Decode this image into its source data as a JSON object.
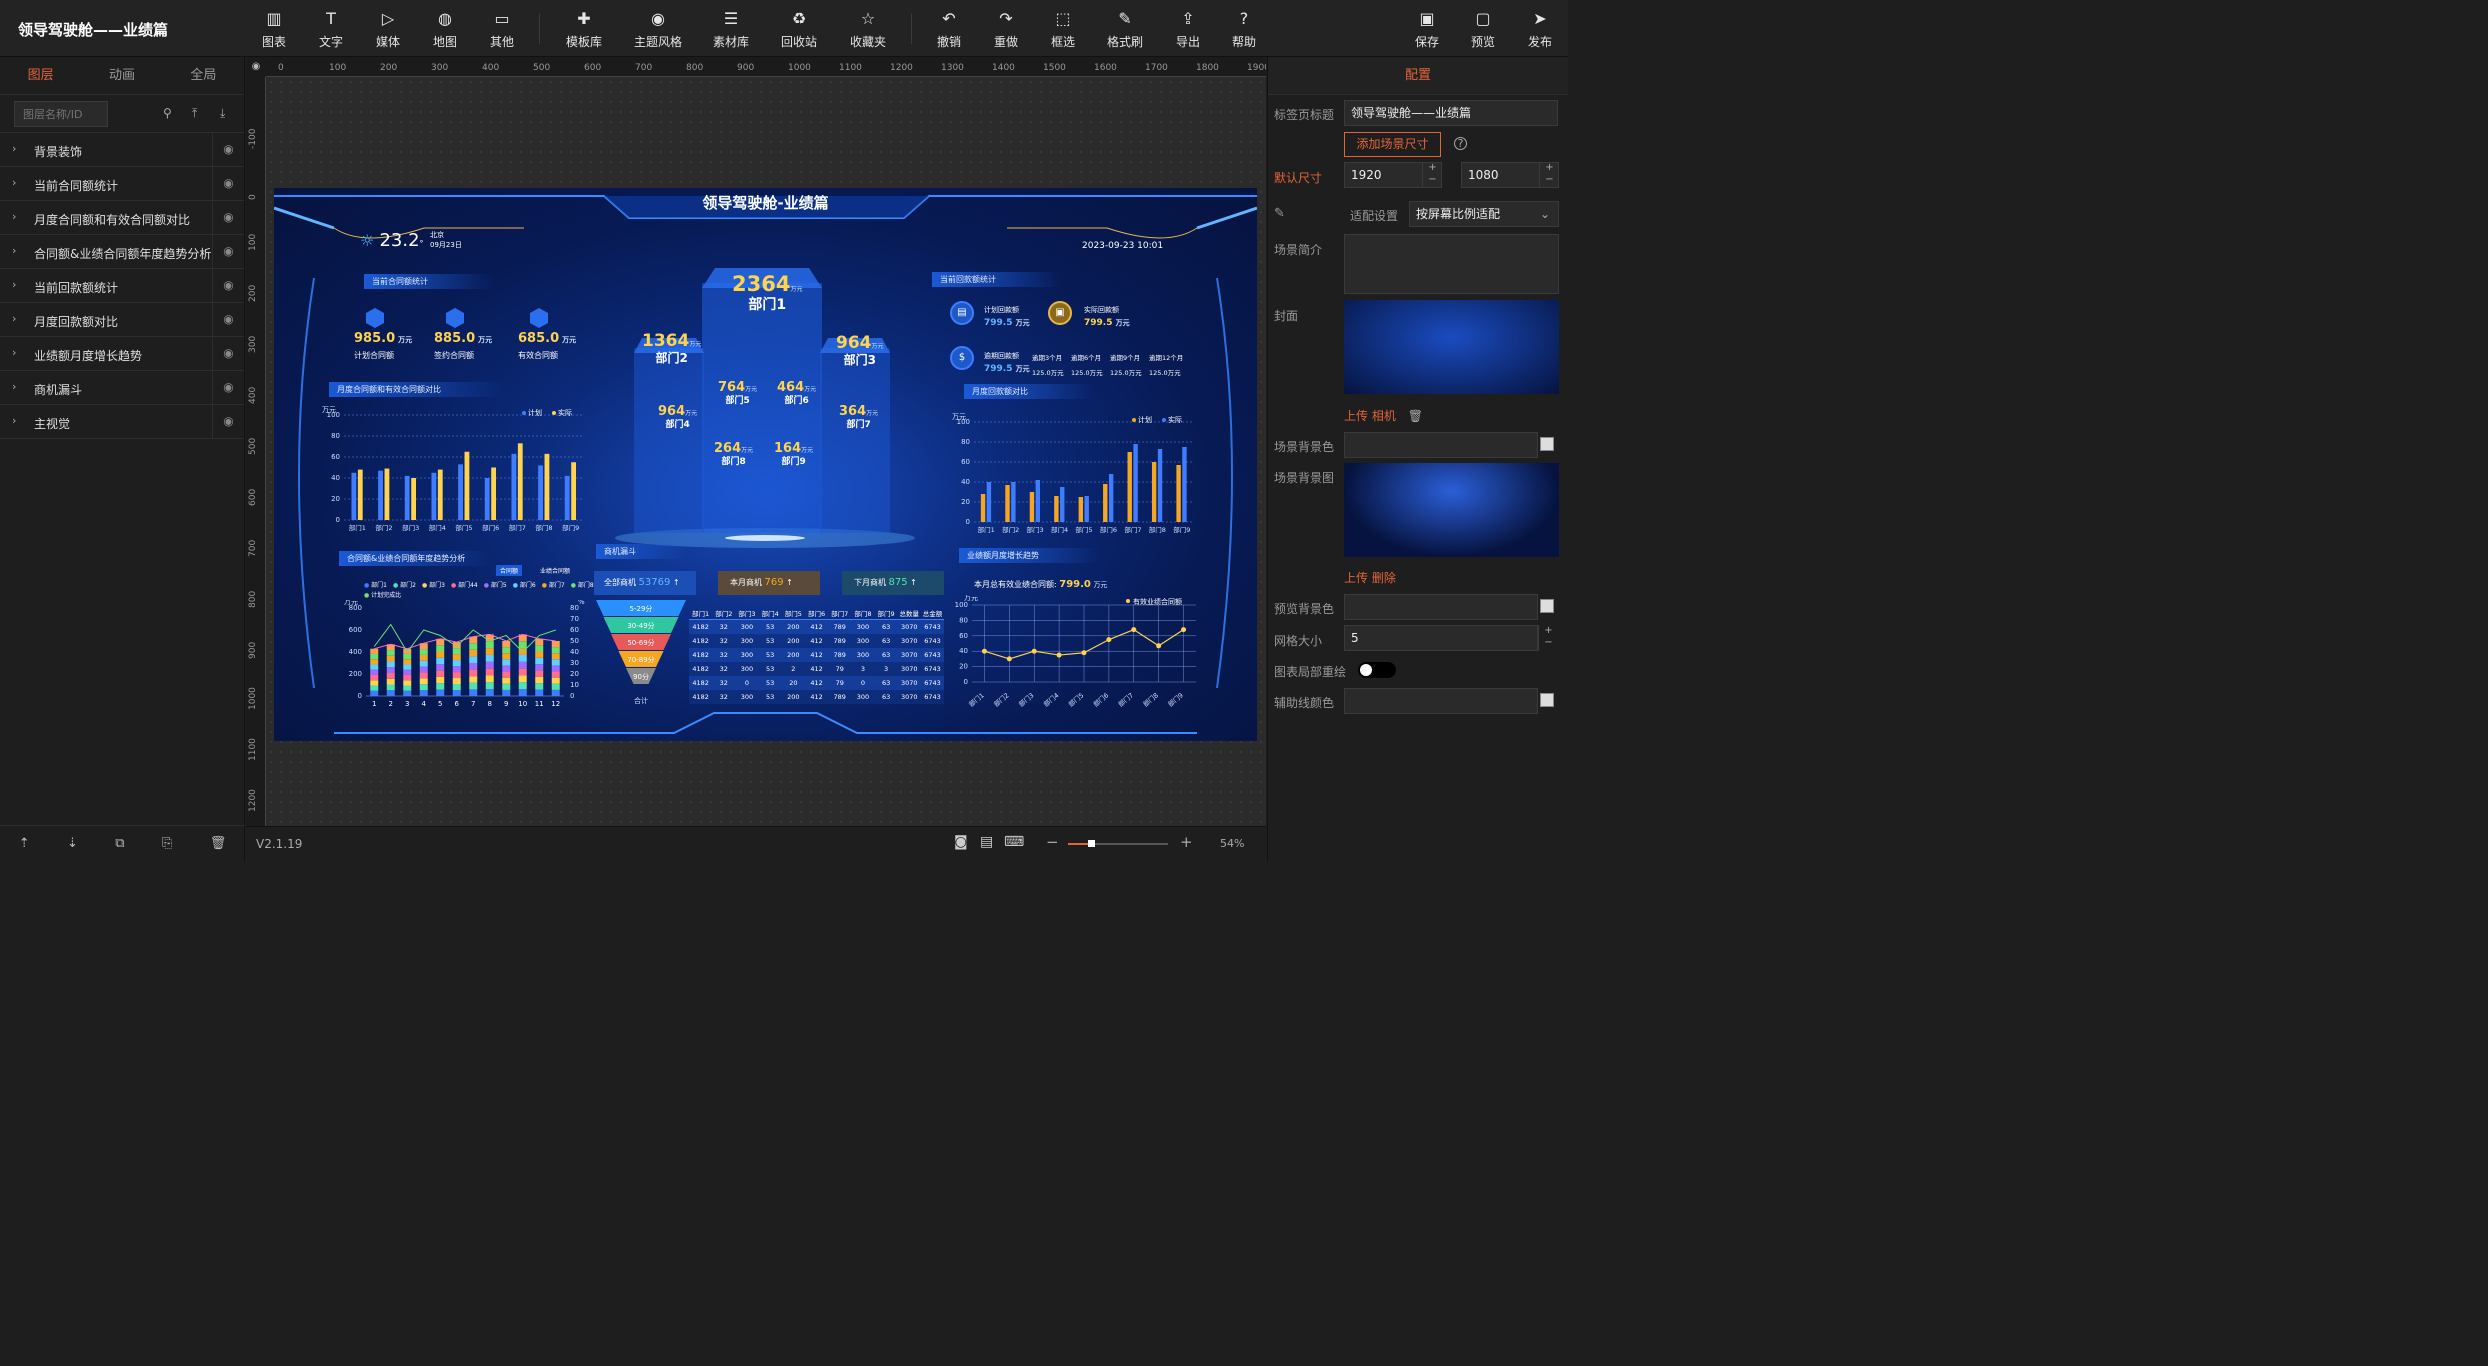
{
  "app": {
    "title": "领导驾驶舱——业绩篇",
    "version": "V2.1.19",
    "zoom": "54%"
  },
  "toolbar": {
    "left": [
      {
        "icon": "chart-icon",
        "glyph": "▥",
        "label": "图表"
      },
      {
        "icon": "text-icon",
        "glyph": "T",
        "label": "文字"
      },
      {
        "icon": "media-icon",
        "glyph": "▷",
        "label": "媒体"
      },
      {
        "icon": "map-icon",
        "glyph": "◍",
        "label": "地图"
      },
      {
        "icon": "other-icon",
        "glyph": "▭",
        "label": "其他"
      }
    ],
    "middle": [
      {
        "icon": "template-icon",
        "glyph": "✚",
        "label": "模板库"
      },
      {
        "icon": "theme-icon",
        "glyph": "◉",
        "label": "主题风格"
      },
      {
        "icon": "assets-icon",
        "glyph": "☰",
        "label": "素材库"
      },
      {
        "icon": "recycle-icon",
        "glyph": "♻",
        "label": "回收站"
      },
      {
        "icon": "star-icon",
        "glyph": "☆",
        "label": "收藏夹"
      }
    ],
    "right": [
      {
        "icon": "undo-icon",
        "glyph": "↶",
        "label": "撤销"
      },
      {
        "icon": "redo-icon",
        "glyph": "↷",
        "label": "重做"
      },
      {
        "icon": "select-icon",
        "glyph": "⬚",
        "label": "框选"
      },
      {
        "icon": "format-brush-icon",
        "glyph": "✎",
        "label": "格式刷"
      },
      {
        "icon": "export-icon",
        "glyph": "⇪",
        "label": "导出"
      },
      {
        "icon": "help-icon",
        "glyph": "?",
        "label": "帮助"
      }
    ],
    "far": [
      {
        "icon": "save-icon",
        "glyph": "▣",
        "label": "保存"
      },
      {
        "icon": "preview-icon",
        "glyph": "▢",
        "label": "预览"
      },
      {
        "icon": "publish-icon",
        "glyph": "➤",
        "label": "发布"
      }
    ]
  },
  "left_panel": {
    "tabs": [
      "图层",
      "动画",
      "全局"
    ],
    "search_placeholder": "图层名称/ID",
    "layers": [
      "背景装饰",
      "当前合同额统计",
      "月度合同额和有效合同额对比",
      "合同额&业绩合同额年度趋势分析",
      "当前回款额统计",
      "月度回款额对比",
      "业绩额月度增长趋势",
      "商机漏斗",
      "主视觉"
    ]
  },
  "ruler": {
    "x_ticks": [
      "0",
      "100",
      "200",
      "300",
      "400",
      "500",
      "600",
      "700",
      "800",
      "900",
      "1000",
      "1100",
      "1200",
      "1300",
      "1400",
      "1500",
      "1600",
      "1700",
      "1800",
      "1900"
    ],
    "y_ticks": [
      "-100",
      "0",
      "100",
      "200",
      "300",
      "400",
      "500",
      "600",
      "700",
      "800",
      "900",
      "1000",
      "1100",
      "1200"
    ]
  },
  "right_panel": {
    "header": "配置",
    "tab_title_label": "标签页标题",
    "tab_title_value": "领导驾驶舱——业绩篇",
    "add_size_button": "添加场景尺寸",
    "default_size_label": "默认尺寸",
    "width": "1920",
    "height": "1080",
    "fit_label": "适配设置",
    "fit_value": "按屏幕比例适配",
    "intro_label": "场景简介",
    "cover_label": "封面",
    "upload": "上传",
    "camera": "相机",
    "delete": "删除",
    "bg_color_label": "场景背景色",
    "bg_image_label": "场景背景图",
    "preview_bg_label": "预览背景色",
    "grid_label": "网格大小",
    "grid_value": "5",
    "local_redraw_label": "图表局部重绘",
    "guide_color_label": "辅助线颜色"
  },
  "screen": {
    "title": "领导驾驶舱-业绩篇",
    "temp": "23.2",
    "temp_unit": "°",
    "city": "北京",
    "date": "09月23日",
    "datetime": "2023-09-23 10:01",
    "contract": {
      "title": "当前合同额统计",
      "items": [
        {
          "v": "985.0",
          "u": "万元",
          "l": "计划合同额"
        },
        {
          "v": "885.0",
          "u": "万元",
          "l": "签约合同额"
        },
        {
          "v": "685.0",
          "u": "万元",
          "l": "有效合同额"
        }
      ]
    },
    "depts": [
      {
        "v": "2364",
        "n": "部门1"
      },
      {
        "v": "1364",
        "n": "部门2"
      },
      {
        "v": "964",
        "n": "部门3"
      },
      {
        "v": "964",
        "n": "部门4"
      },
      {
        "v": "764",
        "n": "部门5"
      },
      {
        "v": "464",
        "n": "部门6"
      },
      {
        "v": "364",
        "n": "部门7"
      },
      {
        "v": "264",
        "n": "部门8"
      },
      {
        "v": "164",
        "n": "部门9"
      }
    ],
    "dept_unit": "万元",
    "payback": {
      "title": "当前回款额统计",
      "plan_label": "计划回款额",
      "plan": "799.5",
      "actual_label": "实际回款额",
      "actual": "799.5",
      "overdue_label": "逾期回款额",
      "overdue": "799.5",
      "unit": "万元",
      "periods": [
        {
          "l": "逾期3个月",
          "v": "125.0万元"
        },
        {
          "l": "逾期6个月",
          "v": "125.0万元"
        },
        {
          "l": "逾期9个月",
          "v": "125.0万元"
        },
        {
          "l": "逾期12个月",
          "v": "125.0万元"
        }
      ]
    },
    "monthly_contract": {
      "title": "月度合同额和有效合同额对比",
      "unit": "万元",
      "legend": [
        "计划",
        "实际"
      ]
    },
    "monthly_payback": {
      "title": "月度回款额对比",
      "unit": "万元",
      "legend": [
        "计划",
        "实际"
      ]
    },
    "trend": {
      "title": "合同额&业绩合同额年度趋势分析",
      "tabs": [
        "合同额",
        "业绩合同额"
      ],
      "legend": [
        "部门1",
        "部门2",
        "部门3",
        "部门44",
        "部门5",
        "部门6",
        "部门7",
        "部门8",
        "部门9",
        "总合同额",
        "计划完成比"
      ],
      "unit": "万元",
      "unit2": "%"
    },
    "funnel": {
      "title": "商机漏斗",
      "all_label": "全部商机",
      "all": "53769",
      "month_label": "本月商机",
      "month": "769",
      "next_label": "下月商机",
      "next": "875",
      "stages": [
        "5-29分",
        "30-49分",
        "50-69分",
        "70-89分",
        "90分"
      ],
      "total": "合计",
      "headers": [
        "部门1",
        "部门2",
        "部门3",
        "部门4",
        "部门5",
        "部门6",
        "部门7",
        "部门8",
        "部门9",
        "总数量",
        "总金额"
      ],
      "rows": [
        [
          "4182",
          "32",
          "300",
          "53",
          "200",
          "412",
          "789",
          "300",
          "63",
          "3070",
          "6743"
        ],
        [
          "4182",
          "32",
          "300",
          "53",
          "200",
          "412",
          "789",
          "300",
          "63",
          "3070",
          "6743"
        ],
        [
          "4182",
          "32",
          "300",
          "53",
          "200",
          "412",
          "789",
          "300",
          "63",
          "3070",
          "6743"
        ],
        [
          "4182",
          "32",
          "300",
          "53",
          "2",
          "412",
          "79",
          "3",
          "3",
          "3070",
          "6743"
        ],
        [
          "4182",
          "32",
          "0",
          "53",
          "20",
          "412",
          "79",
          "0",
          "63",
          "3070",
          "6743"
        ],
        [
          "4182",
          "32",
          "300",
          "53",
          "200",
          "412",
          "789",
          "300",
          "63",
          "3070",
          "6743"
        ]
      ]
    },
    "growth": {
      "title": "业绩额月度增长趋势",
      "label": "本月总有效业绩合同额:",
      "value": "799.0",
      "unit": "万元",
      "series": "有效业绩合同额",
      "yunit": "万元"
    }
  },
  "chart_data": [
    {
      "type": "bar",
      "title": "月度合同额和有效合同额对比",
      "categories": [
        "部门1",
        "部门2",
        "部门3",
        "部门4",
        "部门5",
        "部门6",
        "部门7",
        "部门8",
        "部门9"
      ],
      "ylabel": "万元",
      "ylim": [
        0,
        100
      ],
      "series": [
        {
          "name": "计划",
          "values": [
            45,
            47,
            42,
            45,
            53,
            40,
            63,
            52,
            42
          ]
        },
        {
          "name": "实际",
          "values": [
            48,
            49,
            40,
            48,
            65,
            50,
            73,
            63,
            55
          ]
        }
      ],
      "colors": [
        "#3f7dff",
        "#ffd34d"
      ]
    },
    {
      "type": "bar",
      "title": "月度回款额对比",
      "categories": [
        "部门1",
        "部门2",
        "部门3",
        "部门4",
        "部门5",
        "部门6",
        "部门7",
        "部门8",
        "部门9"
      ],
      "ylabel": "万元",
      "ylim": [
        0,
        100
      ],
      "series": [
        {
          "name": "计划",
          "values": [
            28,
            37,
            30,
            26,
            25,
            38,
            70,
            60,
            57
          ]
        },
        {
          "name": "实际",
          "values": [
            40,
            40,
            42,
            35,
            26,
            48,
            78,
            73,
            75
          ]
        }
      ],
      "colors": [
        "#f5a623",
        "#3f7dff"
      ]
    },
    {
      "type": "line",
      "title": "业绩额月度增长趋势",
      "categories": [
        "部门1",
        "部门2",
        "部门3",
        "部门4",
        "部门5",
        "部门6",
        "部门7",
        "部门8",
        "部门9"
      ],
      "ylabel": "万元",
      "ylim": [
        0,
        100
      ],
      "series": [
        {
          "name": "有效业绩合同额",
          "values": [
            40,
            30,
            40,
            35,
            38,
            55,
            68,
            47,
            68
          ]
        }
      ]
    },
    {
      "type": "bar",
      "title": "合同额&业绩合同额年度趋势分析",
      "categories": [
        "1",
        "2",
        "3",
        "4",
        "5",
        "6",
        "7",
        "8",
        "9",
        "10",
        "11",
        "12"
      ],
      "ylim": [
        0,
        800
      ],
      "y2lim": [
        0,
        80
      ],
      "series": [
        {
          "name": "总合同额",
          "values": [
            430,
            470,
            430,
            480,
            520,
            490,
            540,
            560,
            500,
            560,
            520,
            500
          ]
        },
        {
          "name": "计划完成比",
          "values": [
            45,
            65,
            40,
            60,
            55,
            45,
            60,
            50,
            55,
            40,
            55,
            60
          ]
        }
      ]
    }
  ]
}
